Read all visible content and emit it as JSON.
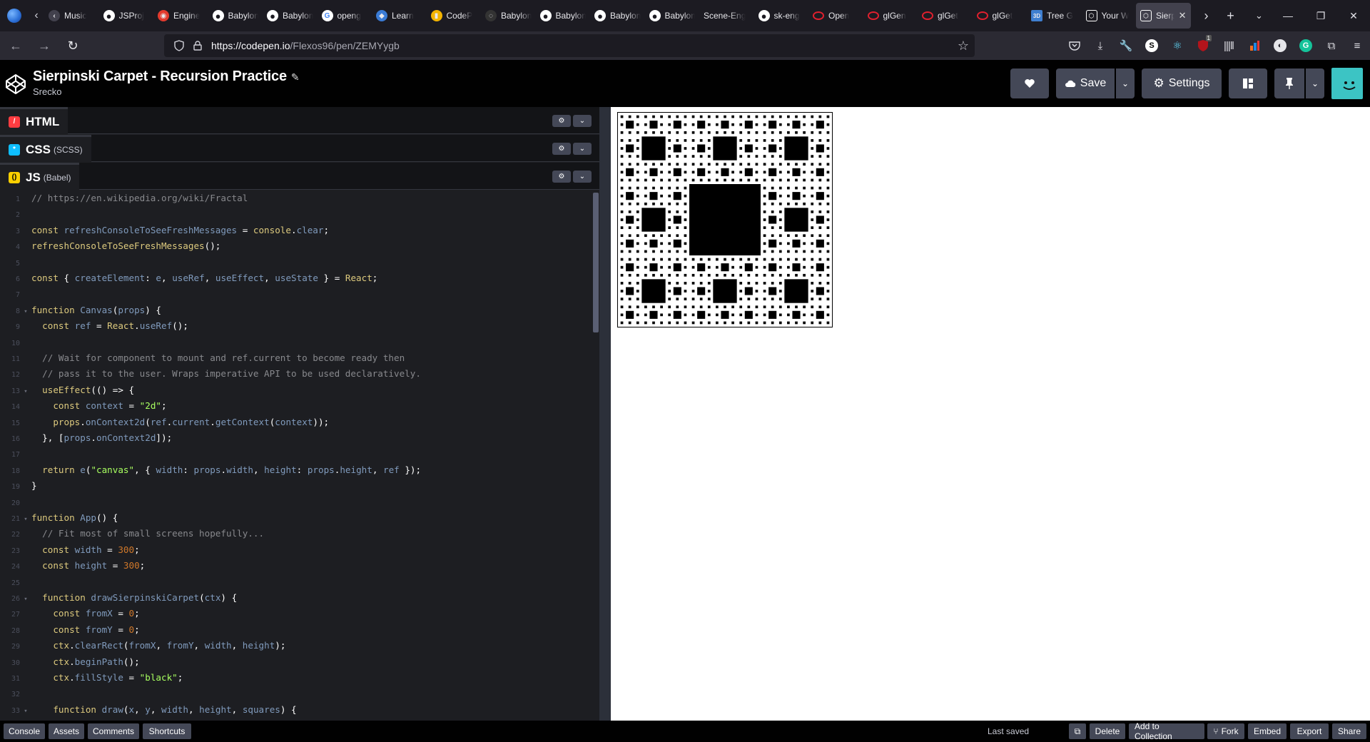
{
  "browser": {
    "tabs": [
      {
        "label": "Music",
        "icon": "back-arrow-icon",
        "color": "#42414d"
      },
      {
        "label": "JSProj",
        "icon": "github-icon",
        "color": "#ffffff"
      },
      {
        "label": "Engine",
        "icon": "engine-icon",
        "color": "#e33b2e"
      },
      {
        "label": "Babylon",
        "icon": "github-icon",
        "color": "#ffffff"
      },
      {
        "label": "Babylon",
        "icon": "github-icon",
        "color": "#ffffff"
      },
      {
        "label": "openg",
        "icon": "google-icon",
        "color": "#ffffff"
      },
      {
        "label": "Learn",
        "icon": "learn-icon",
        "color": "#3a7bd5"
      },
      {
        "label": "CodeP",
        "icon": "chart-icon",
        "color": "#f4b400"
      },
      {
        "label": "Babylon",
        "icon": "babylon-icon",
        "color": "#333333"
      },
      {
        "label": "Babylon",
        "icon": "github-icon",
        "color": "#ffffff"
      },
      {
        "label": "Babylon",
        "icon": "github-icon",
        "color": "#ffffff"
      },
      {
        "label": "Babylon",
        "icon": "github-icon",
        "color": "#ffffff"
      },
      {
        "label": "Scene-Eng",
        "icon": "none",
        "color": "#1c1b22"
      },
      {
        "label": "sk-eng",
        "icon": "github-icon",
        "color": "#ffffff"
      },
      {
        "label": "Open",
        "icon": "opera-icon",
        "color": "#e0202e"
      },
      {
        "label": "glGen",
        "icon": "opera-icon",
        "color": "#e0202e"
      },
      {
        "label": "glGet",
        "icon": "opera-icon",
        "color": "#e0202e"
      },
      {
        "label": "glGet",
        "icon": "opera-icon",
        "color": "#e0202e"
      },
      {
        "label": "Tree G",
        "icon": "3d-icon",
        "color": "#3f7fd0"
      },
      {
        "label": "Your W",
        "icon": "codepen-icon",
        "color": "#ffffff"
      },
      {
        "label": "Sierp",
        "icon": "codepen-icon",
        "color": "#ffffff",
        "active": true
      }
    ],
    "url_domain": "https://codepen.io",
    "url_path": "/Flexos96/pen/ZEMYygb",
    "extension_badge": "1"
  },
  "pen": {
    "title": "Sierpinski Carpet - Recursion Practice",
    "author": "Srecko",
    "save_label": "Save",
    "settings_label": "Settings"
  },
  "panes": {
    "html": {
      "label": "HTML",
      "sub": "",
      "color": "#ff3c41"
    },
    "css": {
      "label": "CSS",
      "sub": "(SCSS)",
      "color": "#0ebeff"
    },
    "js": {
      "label": "JS",
      "sub": "(Babel)",
      "color": "#fcd000"
    }
  },
  "code": [
    {
      "n": "1",
      "fold": false,
      "tokens": [
        [
          "cm",
          "// https://en.wikipedia.org/wiki/Fractal"
        ]
      ]
    },
    {
      "n": "2",
      "fold": false,
      "tokens": []
    },
    {
      "n": "3",
      "fold": false,
      "tokens": [
        [
          "kw",
          "const "
        ],
        [
          "var",
          "refreshConsoleToSeeFreshMessages"
        ],
        [
          "plain",
          " = "
        ],
        [
          "kw",
          "console"
        ],
        [
          "plain",
          "."
        ],
        [
          "var",
          "clear"
        ],
        [
          "plain",
          ";"
        ]
      ]
    },
    {
      "n": "4",
      "fold": false,
      "tokens": [
        [
          "kw",
          "refreshConsoleToSeeFreshMessages"
        ],
        [
          "plain",
          "();"
        ]
      ]
    },
    {
      "n": "5",
      "fold": false,
      "tokens": []
    },
    {
      "n": "6",
      "fold": false,
      "tokens": [
        [
          "kw",
          "const "
        ],
        [
          "plain",
          "{ "
        ],
        [
          "var",
          "createElement"
        ],
        [
          "plain",
          ": "
        ],
        [
          "var",
          "e"
        ],
        [
          "plain",
          ", "
        ],
        [
          "var",
          "useRef"
        ],
        [
          "plain",
          ", "
        ],
        [
          "var",
          "useEffect"
        ],
        [
          "plain",
          ", "
        ],
        [
          "var",
          "useState"
        ],
        [
          "plain",
          " } = "
        ],
        [
          "kw",
          "React"
        ],
        [
          "plain",
          ";"
        ]
      ]
    },
    {
      "n": "7",
      "fold": false,
      "tokens": []
    },
    {
      "n": "8",
      "fold": true,
      "tokens": [
        [
          "kw",
          "function "
        ],
        [
          "var",
          "Canvas"
        ],
        [
          "plain",
          "("
        ],
        [
          "var",
          "props"
        ],
        [
          "plain",
          ") {"
        ]
      ]
    },
    {
      "n": "9",
      "fold": false,
      "tokens": [
        [
          "kw",
          "  const "
        ],
        [
          "var",
          "ref"
        ],
        [
          "plain",
          " = "
        ],
        [
          "kw",
          "React"
        ],
        [
          "plain",
          "."
        ],
        [
          "var",
          "useRef"
        ],
        [
          "plain",
          "();"
        ]
      ]
    },
    {
      "n": "10",
      "fold": false,
      "tokens": []
    },
    {
      "n": "11",
      "fold": false,
      "tokens": [
        [
          "cm",
          "  // Wait for component to mount and ref.current to become ready then"
        ]
      ]
    },
    {
      "n": "12",
      "fold": false,
      "tokens": [
        [
          "cm",
          "  // pass it to the user. Wraps imperative API to be used declaratively."
        ]
      ]
    },
    {
      "n": "13",
      "fold": true,
      "tokens": [
        [
          "kw",
          "  useEffect"
        ],
        [
          "plain",
          "(() => {"
        ]
      ]
    },
    {
      "n": "14",
      "fold": false,
      "tokens": [
        [
          "kw",
          "    const "
        ],
        [
          "var",
          "context"
        ],
        [
          "plain",
          " = "
        ],
        [
          "str",
          "\"2d\""
        ],
        [
          "plain",
          ";"
        ]
      ]
    },
    {
      "n": "15",
      "fold": false,
      "tokens": [
        [
          "kw",
          "    props"
        ],
        [
          "plain",
          "."
        ],
        [
          "var",
          "onContext2d"
        ],
        [
          "plain",
          "("
        ],
        [
          "var",
          "ref"
        ],
        [
          "plain",
          "."
        ],
        [
          "var",
          "current"
        ],
        [
          "plain",
          "."
        ],
        [
          "var",
          "getContext"
        ],
        [
          "plain",
          "("
        ],
        [
          "var",
          "context"
        ],
        [
          "plain",
          "));"
        ]
      ]
    },
    {
      "n": "16",
      "fold": false,
      "tokens": [
        [
          "plain",
          "  }, ["
        ],
        [
          "var",
          "props"
        ],
        [
          "plain",
          "."
        ],
        [
          "var",
          "onContext2d"
        ],
        [
          "plain",
          "]);"
        ]
      ]
    },
    {
      "n": "17",
      "fold": false,
      "tokens": []
    },
    {
      "n": "18",
      "fold": false,
      "tokens": [
        [
          "kw",
          "  return "
        ],
        [
          "var",
          "e"
        ],
        [
          "plain",
          "("
        ],
        [
          "str",
          "\"canvas\""
        ],
        [
          "plain",
          ", { "
        ],
        [
          "var",
          "width"
        ],
        [
          "plain",
          ": "
        ],
        [
          "var",
          "props"
        ],
        [
          "plain",
          "."
        ],
        [
          "var",
          "width"
        ],
        [
          "plain",
          ", "
        ],
        [
          "var",
          "height"
        ],
        [
          "plain",
          ": "
        ],
        [
          "var",
          "props"
        ],
        [
          "plain",
          "."
        ],
        [
          "var",
          "height"
        ],
        [
          "plain",
          ", "
        ],
        [
          "var",
          "ref"
        ],
        [
          "plain",
          " });"
        ]
      ]
    },
    {
      "n": "19",
      "fold": false,
      "tokens": [
        [
          "plain",
          "}"
        ]
      ]
    },
    {
      "n": "20",
      "fold": false,
      "tokens": []
    },
    {
      "n": "21",
      "fold": true,
      "tokens": [
        [
          "kw",
          "function "
        ],
        [
          "var",
          "App"
        ],
        [
          "plain",
          "() {"
        ]
      ]
    },
    {
      "n": "22",
      "fold": false,
      "tokens": [
        [
          "cm",
          "  // Fit most of small screens hopefully..."
        ]
      ]
    },
    {
      "n": "23",
      "fold": false,
      "tokens": [
        [
          "kw",
          "  const "
        ],
        [
          "var",
          "width"
        ],
        [
          "plain",
          " = "
        ],
        [
          "num",
          "300"
        ],
        [
          "plain",
          ";"
        ]
      ]
    },
    {
      "n": "24",
      "fold": false,
      "tokens": [
        [
          "kw",
          "  const "
        ],
        [
          "var",
          "height"
        ],
        [
          "plain",
          " = "
        ],
        [
          "num",
          "300"
        ],
        [
          "plain",
          ";"
        ]
      ]
    },
    {
      "n": "25",
      "fold": false,
      "tokens": []
    },
    {
      "n": "26",
      "fold": true,
      "tokens": [
        [
          "kw",
          "  function "
        ],
        [
          "var",
          "drawSierpinskiCarpet"
        ],
        [
          "plain",
          "("
        ],
        [
          "var",
          "ctx"
        ],
        [
          "plain",
          ") {"
        ]
      ]
    },
    {
      "n": "27",
      "fold": false,
      "tokens": [
        [
          "kw",
          "    const "
        ],
        [
          "var",
          "fromX"
        ],
        [
          "plain",
          " = "
        ],
        [
          "num",
          "0"
        ],
        [
          "plain",
          ";"
        ]
      ]
    },
    {
      "n": "28",
      "fold": false,
      "tokens": [
        [
          "kw",
          "    const "
        ],
        [
          "var",
          "fromY"
        ],
        [
          "plain",
          " = "
        ],
        [
          "num",
          "0"
        ],
        [
          "plain",
          ";"
        ]
      ]
    },
    {
      "n": "29",
      "fold": false,
      "tokens": [
        [
          "kw",
          "    ctx"
        ],
        [
          "plain",
          "."
        ],
        [
          "var",
          "clearRect"
        ],
        [
          "plain",
          "("
        ],
        [
          "var",
          "fromX"
        ],
        [
          "plain",
          ", "
        ],
        [
          "var",
          "fromY"
        ],
        [
          "plain",
          ", "
        ],
        [
          "var",
          "width"
        ],
        [
          "plain",
          ", "
        ],
        [
          "var",
          "height"
        ],
        [
          "plain",
          ");"
        ]
      ]
    },
    {
      "n": "30",
      "fold": false,
      "tokens": [
        [
          "kw",
          "    ctx"
        ],
        [
          "plain",
          "."
        ],
        [
          "var",
          "beginPath"
        ],
        [
          "plain",
          "();"
        ]
      ]
    },
    {
      "n": "31",
      "fold": false,
      "tokens": [
        [
          "kw",
          "    ctx"
        ],
        [
          "plain",
          "."
        ],
        [
          "var",
          "fillStyle"
        ],
        [
          "plain",
          " = "
        ],
        [
          "str",
          "\"black\""
        ],
        [
          "plain",
          ";"
        ]
      ]
    },
    {
      "n": "32",
      "fold": false,
      "tokens": []
    },
    {
      "n": "33",
      "fold": true,
      "tokens": [
        [
          "kw",
          "    function "
        ],
        [
          "var",
          "draw"
        ],
        [
          "plain",
          "("
        ],
        [
          "var",
          "x"
        ],
        [
          "plain",
          ", "
        ],
        [
          "var",
          "y"
        ],
        [
          "plain",
          ", "
        ],
        [
          "var",
          "width"
        ],
        [
          "plain",
          ", "
        ],
        [
          "var",
          "height"
        ],
        [
          "plain",
          ", "
        ],
        [
          "var",
          "squares"
        ],
        [
          "plain",
          ") {"
        ]
      ]
    }
  ],
  "footer": {
    "console": "Console",
    "assets": "Assets",
    "comments": "Comments",
    "shortcuts": "Shortcuts",
    "last_saved": "Last saved",
    "delete": "Delete",
    "add_to_collection": "Add to Collection",
    "fork": "Fork",
    "embed": "Embed",
    "export": "Export",
    "share": "Share"
  },
  "preview": {
    "fractal": "sierpinski-carpet",
    "depth": 4,
    "fill": "#000000",
    "background": "#ffffff"
  }
}
